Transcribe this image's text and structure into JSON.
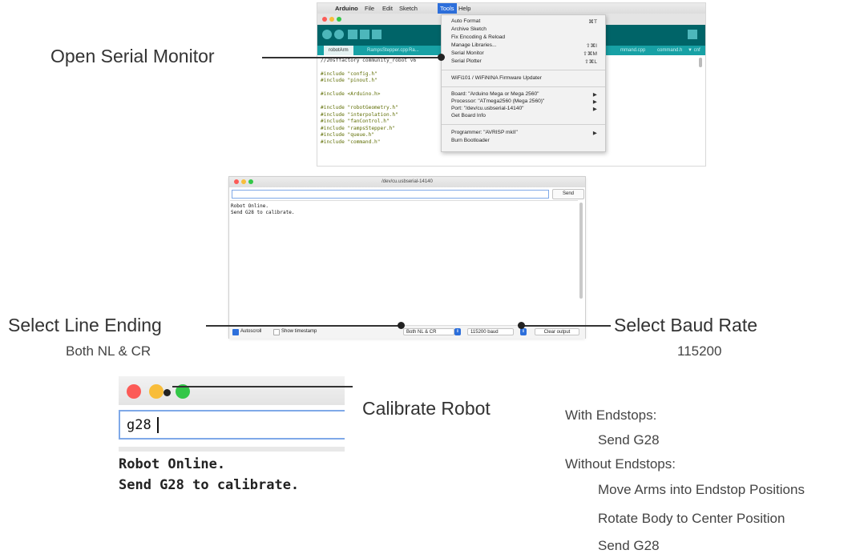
{
  "ide": {
    "menubar": {
      "apple": "",
      "app": "Arduino",
      "items": [
        "File",
        "Edit",
        "Sketch",
        "Tools",
        "Help"
      ]
    },
    "tabs": [
      "robotArm",
      "RampsStepper.cpp",
      "Ra...",
      "mmand.cpp",
      "command.h",
      "▼ cnf"
    ],
    "code_lines": [
      "//20sffactory community_robot v6",
      "",
      "#include \"config.h\"",
      "#include \"pinout.h\"",
      "",
      "#include <Arduino.h>",
      "",
      "#include \"robotGeometry.h\"",
      "#include \"interpolation.h\"",
      "#include \"fanControl.h\"",
      "#include \"rampsStepper.h\"",
      "#include \"queue.h\"",
      "#include \"command.h\""
    ],
    "tools_menu": [
      {
        "label": "Auto Format",
        "shortcut": "⌘T"
      },
      {
        "label": "Archive Sketch",
        "shortcut": ""
      },
      {
        "label": "Fix Encoding & Reload",
        "shortcut": ""
      },
      {
        "label": "Manage Libraries...",
        "shortcut": "⇧⌘I"
      },
      {
        "label": "Serial Monitor",
        "shortcut": "⇧⌘M"
      },
      {
        "label": "Serial Plotter",
        "shortcut": "⇧⌘L"
      },
      {
        "label": "WiFi101 / WiFiNINA Firmware Updater",
        "shortcut": ""
      },
      {
        "label": "Board: \"Arduino Mega or Mega 2560\"",
        "shortcut": "▶"
      },
      {
        "label": "Processor: \"ATmega2560 (Mega 2560)\"",
        "shortcut": "▶"
      },
      {
        "label": "Port: \"/dev/cu.usbserial-14140\"",
        "shortcut": "▶"
      },
      {
        "label": "Get Board Info",
        "shortcut": ""
      },
      {
        "label": "Programmer: \"AVRISP mkII\"",
        "shortcut": "▶"
      },
      {
        "label": "Burn Bootloader",
        "shortcut": ""
      }
    ]
  },
  "serial": {
    "title": "/dev/cu.usbserial-14140",
    "input_value": "",
    "send_label": "Send",
    "output": [
      "Robot Online.",
      "Send G28 to calibrate."
    ],
    "autoscroll_label": "Autoscroll",
    "autoscroll_checked": true,
    "timestamp_label": "Show timestamp",
    "timestamp_checked": false,
    "line_ending": "Both NL & CR",
    "baud": "115200 baud",
    "clear_label": "Clear output"
  },
  "zoom": {
    "input_value": "g28",
    "output": [
      "Robot Online.",
      "Send G28 to calibrate."
    ]
  },
  "annotations": {
    "open_serial": "Open Serial Monitor",
    "line_ending_title": "Select Line Ending",
    "line_ending_value": "Both NL & CR",
    "baud_title": "Select Baud Rate",
    "baud_value": "115200",
    "calibrate": "Calibrate Robot"
  },
  "notes": [
    "With Endstops:",
    "Send G28",
    "Without Endstops:",
    "Move Arms into Endstop Positions",
    "Rotate Body to Center Position",
    "Send G28"
  ],
  "colors": {
    "toolbar": "#006468",
    "tabs": "#17a1a5",
    "menu_highlight": "#2d6fdb",
    "close": "#fc5b57",
    "minimize": "#f8bd3b",
    "maximize": "#33c748"
  }
}
